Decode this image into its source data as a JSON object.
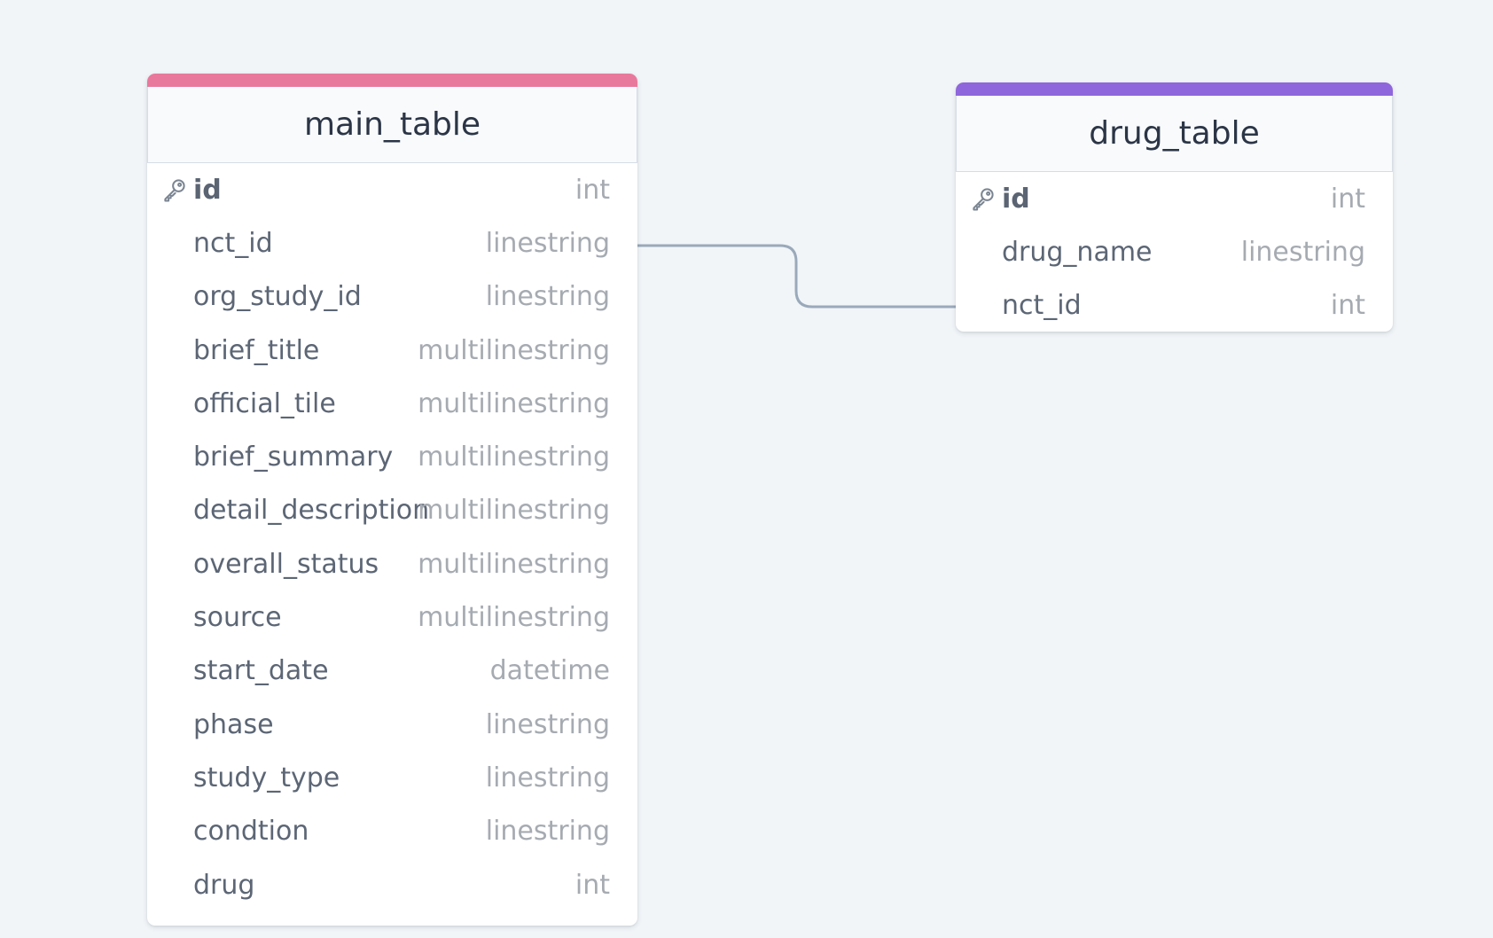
{
  "colors": {
    "background": "#f1f5f8",
    "main_accent": "#e8799c",
    "drug_accent": "#8f66db",
    "connector": "#9aa9ba"
  },
  "tables": {
    "main": {
      "title": "main_table",
      "rows": [
        {
          "name": "id",
          "type": "int",
          "pk": true,
          "icon": "key-icon"
        },
        {
          "name": "nct_id",
          "type": "linestring"
        },
        {
          "name": "org_study_id",
          "type": "linestring"
        },
        {
          "name": "brief_title",
          "type": "multilinestring"
        },
        {
          "name": "official_tile",
          "type": "multilinestring"
        },
        {
          "name": "brief_summary",
          "type": "multilinestring"
        },
        {
          "name": "detail_description",
          "type": "multilinestring"
        },
        {
          "name": "overall_status",
          "type": "multilinestring"
        },
        {
          "name": "source",
          "type": "multilinestring"
        },
        {
          "name": "start_date",
          "type": "datetime"
        },
        {
          "name": "phase",
          "type": "linestring"
        },
        {
          "name": "study_type",
          "type": "linestring"
        },
        {
          "name": "condtion",
          "type": "linestring"
        },
        {
          "name": "drug",
          "type": "int"
        }
      ]
    },
    "drug": {
      "title": "drug_table",
      "rows": [
        {
          "name": "id",
          "type": "int",
          "pk": true,
          "icon": "key-icon"
        },
        {
          "name": "drug_name",
          "type": "linestring"
        },
        {
          "name": "nct_id",
          "type": "int"
        }
      ]
    }
  },
  "relationships": [
    {
      "from": "main_table.nct_id",
      "to": "drug_table.nct_id"
    }
  ]
}
